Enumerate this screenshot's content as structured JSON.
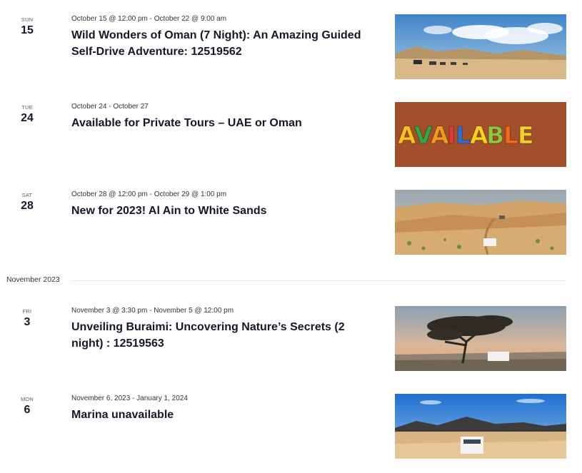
{
  "events": [
    {
      "dow": "SUN",
      "day": "15",
      "meta": "October 15 @ 12:00 pm - October 22 @ 9:00 am",
      "title": "Wild Wonders of Oman (7 Night): An Amazing Guided Self-Drive Adventure: 12519562",
      "image": "desert-convoy-image"
    },
    {
      "dow": "TUE",
      "day": "24",
      "meta": "October 24 - October 27",
      "title": "Available for Private Tours – UAE or Oman",
      "image": "available-letters-image",
      "image_text": "AVAILABLE"
    },
    {
      "dow": "SAT",
      "day": "28",
      "meta": "October 28 @ 12:00 pm - October 29 @ 1:00 pm",
      "title": "New for 2023! Al Ain to White Sands",
      "image": "sand-dunes-image"
    },
    {
      "dow": "FRI",
      "day": "3",
      "meta": "November 3 @ 3:30 pm - November 5 @ 12:00 pm",
      "title": "Unveiling Buraimi: Uncovering Nature’s Secrets (2 night) : 12519563",
      "image": "acacia-sunset-image"
    },
    {
      "dow": "MON",
      "day": "6",
      "meta": "November 6, 2023 - January 1, 2024",
      "title": "Marina unavailable",
      "image": "desert-mountains-image"
    }
  ],
  "month_separator": "November 2023",
  "colors": {
    "title": "#141827",
    "text": "#333333",
    "separator": "#e4e4e4"
  }
}
